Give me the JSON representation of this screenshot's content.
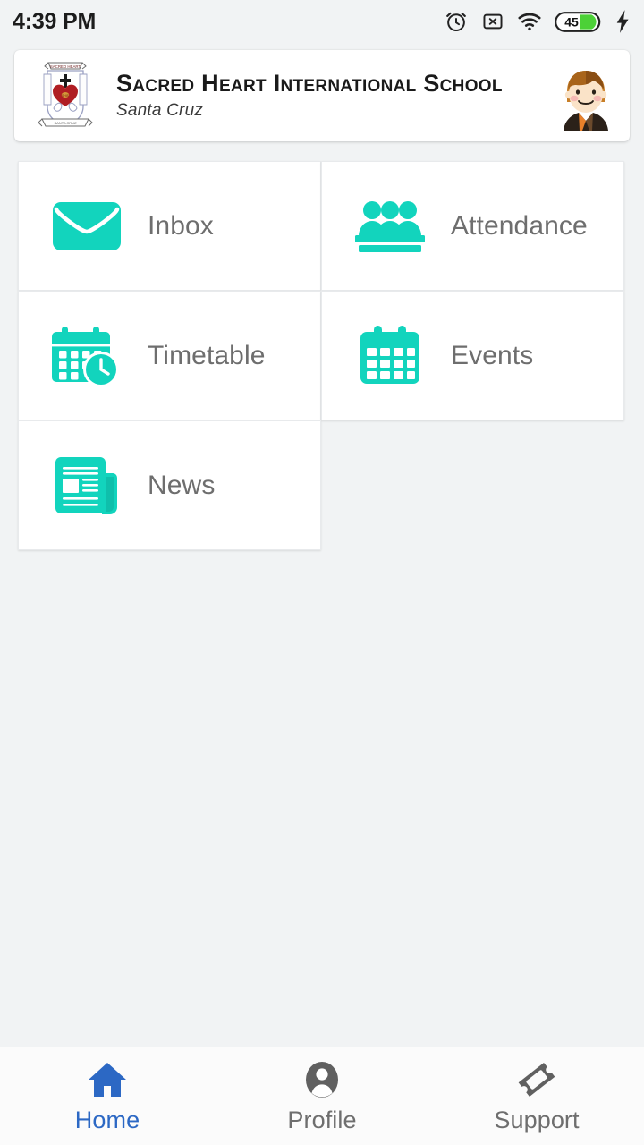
{
  "status_bar": {
    "time": "4:39 PM",
    "icons": [
      {
        "name": "alarm-icon",
        "label": "alarm"
      },
      {
        "name": "no-sim-icon",
        "label": "x-box"
      },
      {
        "name": "wifi-icon",
        "label": "wifi"
      },
      {
        "name": "battery-icon",
        "label": "45"
      },
      {
        "name": "charging-bolt-icon",
        "label": "charging"
      }
    ],
    "battery_percent": "45",
    "battery_fill_color": "#4cd137"
  },
  "header": {
    "school_name": "Sacred Heart International School",
    "location": "Santa Cruz",
    "crest_name": "school-crest-logo",
    "avatar_name": "student-avatar"
  },
  "tiles": [
    {
      "id": "inbox",
      "label": "Inbox",
      "icon": "envelope-icon"
    },
    {
      "id": "attendance",
      "label": "Attendance",
      "icon": "people-podium-icon"
    },
    {
      "id": "timetable",
      "label": "Timetable",
      "icon": "calendar-clock-icon"
    },
    {
      "id": "events",
      "label": "Events",
      "icon": "calendar-icon"
    },
    {
      "id": "news",
      "label": "News",
      "icon": "newspaper-icon"
    }
  ],
  "bottom_nav": [
    {
      "id": "home",
      "label": "Home",
      "icon": "home-icon",
      "active": true
    },
    {
      "id": "profile",
      "label": "Profile",
      "icon": "person-icon",
      "active": false
    },
    {
      "id": "support",
      "label": "Support",
      "icon": "ticket-icon",
      "active": false
    }
  ],
  "colors": {
    "accent_teal": "#12d4bd",
    "active_blue": "#2c68c4",
    "inactive_gray": "#6e6e6e",
    "background": "#f1f3f4",
    "card": "#ffffff"
  }
}
